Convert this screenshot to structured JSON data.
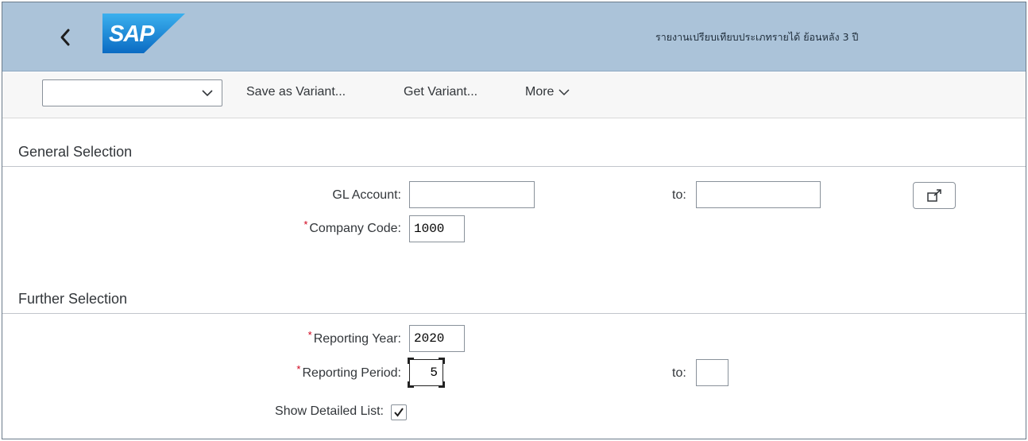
{
  "shell": {
    "app_title": "รายงานเปรียบเทียบประเภทรายได้ ย้อนหลัง 3 ปี",
    "logo_text": "SAP",
    "icons": {
      "back": "chevron-left-icon",
      "logo": "sap-logo"
    },
    "colors": {
      "shell_bg": "#abc3d9",
      "logo_blue": "#1f8ad6"
    }
  },
  "toolbar": {
    "variant_select_value": "",
    "save_variant_label": "Save as Variant...",
    "get_variant_label": "Get Variant...",
    "more_label": "More"
  },
  "general_selection": {
    "title": "General Selection",
    "gl_account_label": "GL Account:",
    "gl_account_from": "",
    "gl_account_to_label": "to:",
    "gl_account_to": "",
    "company_code_label": "Company Code:",
    "company_code_value": "1000",
    "required_marker": "*",
    "multiple_selection_icon": "multiple-selection-icon"
  },
  "further_selection": {
    "title": "Further Selection",
    "reporting_year_label": "Reporting  Year:",
    "reporting_year_value": "2020",
    "reporting_period_label": "Reporting Period:",
    "reporting_period_value": "5",
    "reporting_period_to_label": "to:",
    "reporting_period_to": "",
    "show_detailed_list_label": "Show Detailed List:",
    "show_detailed_list_checked": true,
    "required_marker": "*"
  }
}
